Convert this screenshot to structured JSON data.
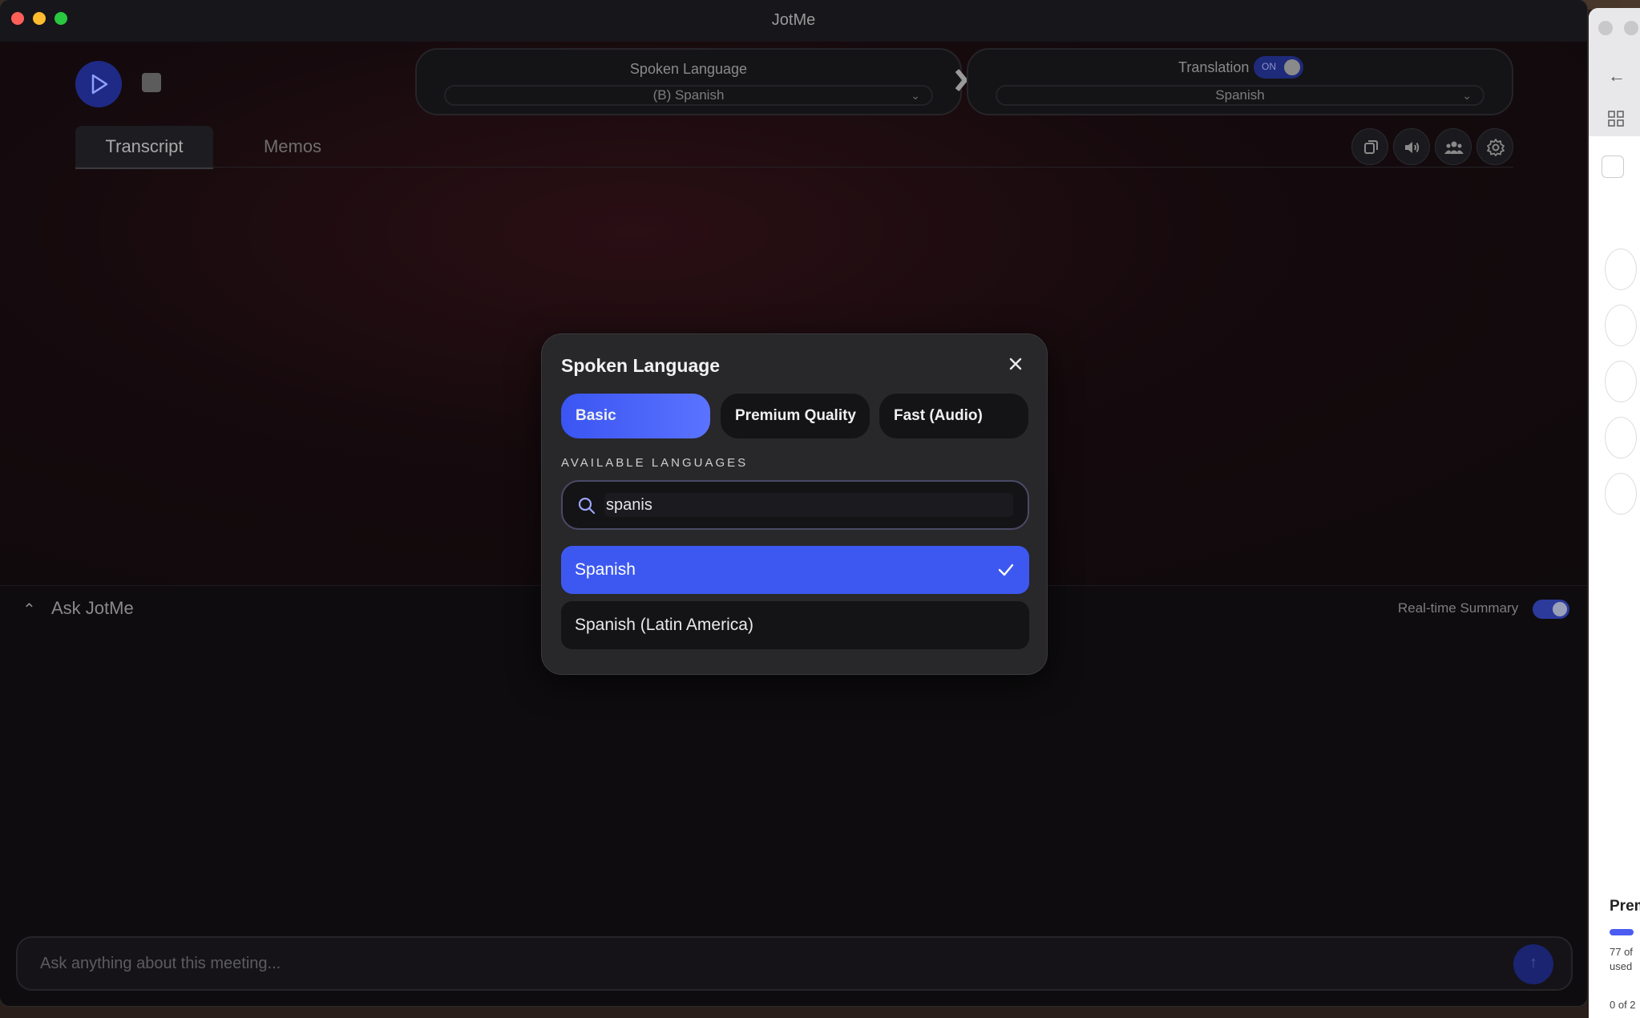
{
  "window": {
    "title": "JotMe"
  },
  "spoken_language": {
    "label": "Spoken Language",
    "value": "(B) Spanish"
  },
  "translation": {
    "label": "Translation",
    "toggle_text": "ON",
    "enabled": true,
    "value": "Spanish"
  },
  "tabs": [
    {
      "label": "Transcript",
      "active": true
    },
    {
      "label": "Memos",
      "active": false
    }
  ],
  "toolbar_icons": [
    "copy-icon",
    "speaker-icon",
    "people-icon",
    "gear-icon"
  ],
  "ask": {
    "title": "Ask JotMe",
    "realtime_summary_label": "Real-time Summary",
    "realtime_summary_enabled": true,
    "input_placeholder": "Ask anything about this meeting..."
  },
  "modal": {
    "title": "Spoken Language",
    "modes": [
      {
        "label": "Basic",
        "active": true
      },
      {
        "label": "Premium Quality",
        "active": false
      },
      {
        "label": "Fast (Audio)",
        "active": false
      }
    ],
    "available_label": "AVAILABLE LANGUAGES",
    "search_value": "spanis",
    "options": [
      {
        "label": "Spanish",
        "selected": true
      },
      {
        "label": "Spanish (Latin America)",
        "selected": false
      }
    ]
  },
  "side_window": {
    "plan_title": "Prem",
    "usage_line1": "77 of",
    "usage_line2": "used",
    "usage_line3": "0 of 2"
  },
  "colors": {
    "accent": "#3d58f0",
    "window_bg": "#0d0a0c",
    "modal_bg": "#28272a"
  }
}
